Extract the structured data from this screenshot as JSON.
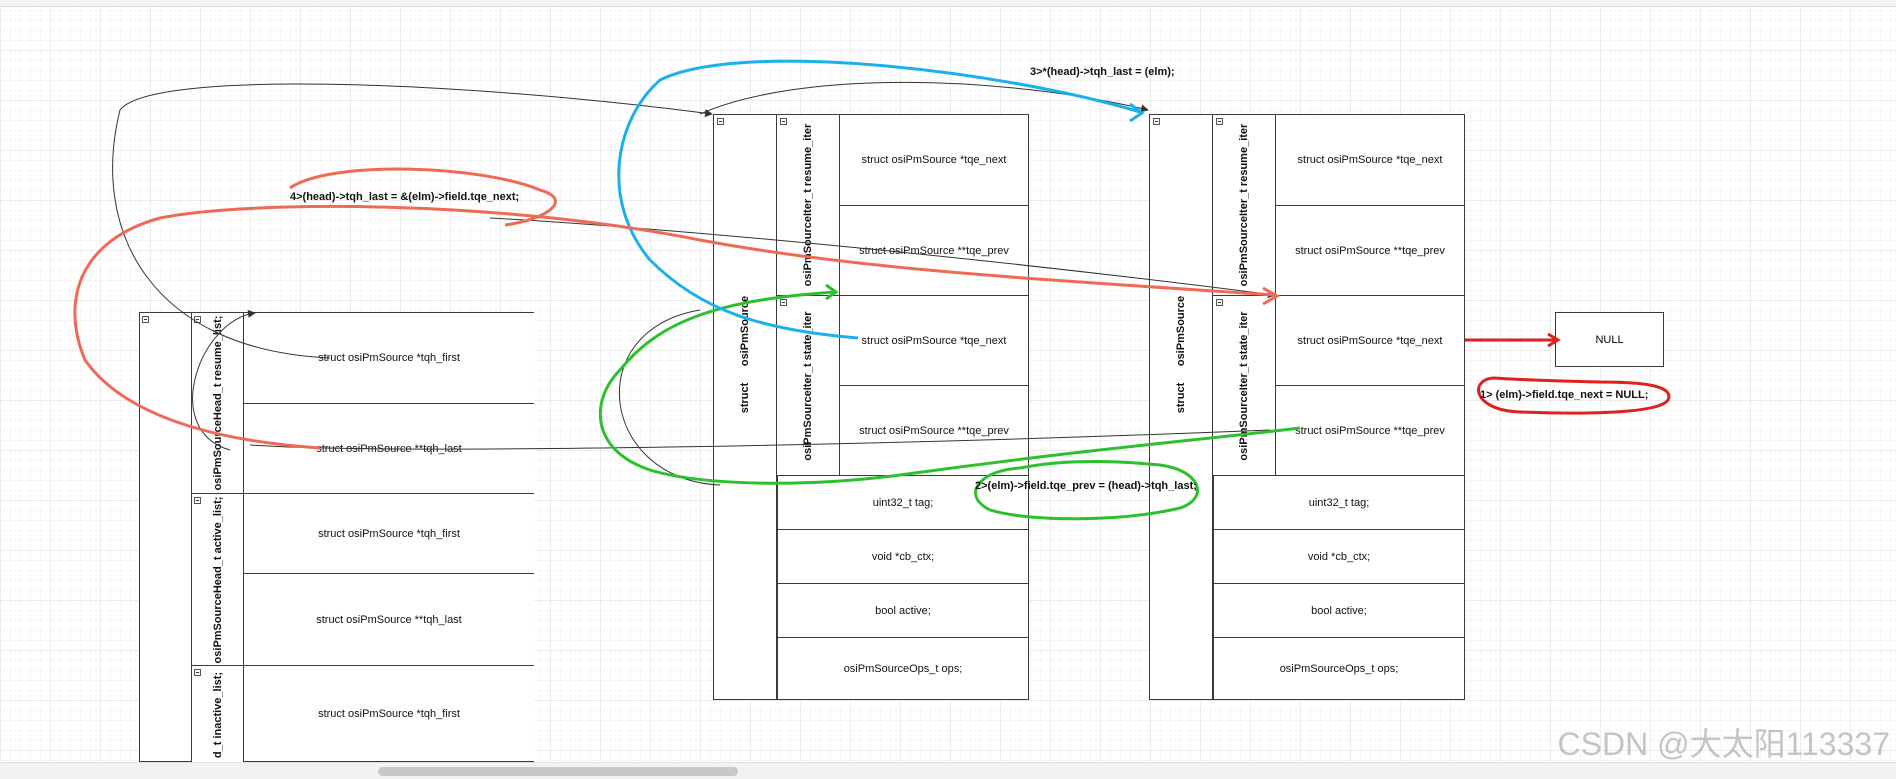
{
  "head_struct": {
    "groups": [
      {
        "label": "osiPmSourceHead_t resume_list;",
        "rows": [
          "struct osiPmSource *tqh_first",
          "struct osiPmSource **tqh_last"
        ]
      },
      {
        "label": "osiPmSourceHead_t active_list;",
        "rows": [
          "struct osiPmSource *tqh_first",
          "struct osiPmSource **tqh_last"
        ]
      },
      {
        "label": "d_t inactive_list;",
        "rows": [
          "struct osiPmSource *tqh_first"
        ]
      }
    ]
  },
  "source_struct_a": {
    "outer_label_top": "osiPmSource",
    "outer_label_bottom": "struct",
    "iter_resume_label": "osiPmSourceIter_t resume_iter",
    "iter_state_label": "osiPmSourceIter_t state_iter",
    "iter_rows": [
      "struct osiPmSource *tqe_next",
      "struct osiPmSource **tqe_prev",
      "struct osiPmSource *tqe_next",
      "struct osiPmSource **tqe_prev"
    ],
    "field_rows": [
      "uint32_t tag;",
      "void *cb_ctx;",
      "bool active;",
      "osiPmSourceOps_t ops;"
    ]
  },
  "source_struct_b": {
    "outer_label_top": "osiPmSource",
    "outer_label_bottom": "struct",
    "iter_resume_label": "osiPmSourceIter_t resume_iter",
    "iter_state_label": "osiPmSourceIter_t state_iter",
    "iter_rows": [
      "struct osiPmSource *tqe_next",
      "struct osiPmSource **tqe_prev",
      "struct osiPmSource *tqe_next",
      "struct osiPmSource **tqe_prev"
    ],
    "field_rows": [
      "uint32_t tag;",
      "void *cb_ctx;",
      "bool active;",
      "osiPmSourceOps_t ops;"
    ]
  },
  "null_box": "NULL",
  "annotations": {
    "step1": "1> (elm)->field.tqe_next = NULL;",
    "step2": "2>(elm)->field.tqe_prev = (head)->tqh_last;",
    "step3": "3>*(head)->tqh_last = (elm);",
    "step4": "4>(head)->tqh_last = &(elm)->field.tqe_next;"
  },
  "colors": {
    "step1": "#e0201e",
    "step2": "#2cc02c",
    "step3": "#1ab0ec",
    "step4": "#ef6a55",
    "connector": "#333333"
  },
  "icons": [
    "collapse-icon"
  ],
  "watermark": "CSDN @大太阳113337"
}
